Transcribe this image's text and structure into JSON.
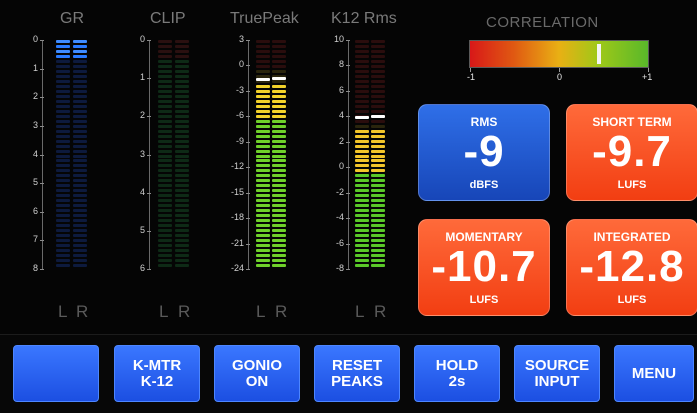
{
  "meters": {
    "gr": {
      "title": "GR",
      "scale": [
        "0",
        "1",
        "2",
        "3",
        "4",
        "5",
        "6",
        "7",
        "8"
      ],
      "left": "L",
      "right": "R"
    },
    "clip": {
      "title": "CLIP",
      "scale": [
        "0",
        "1",
        "2",
        "3",
        "4",
        "5",
        "6"
      ],
      "left": "L",
      "right": "R"
    },
    "truepeak": {
      "title": "TruePeak",
      "scale": [
        "3",
        "0",
        "-3",
        "-6",
        "-9",
        "-12",
        "-15",
        "-18",
        "-21",
        "-24"
      ],
      "left": "L",
      "right": "R",
      "level_db": -2.0,
      "peak_hold_db": -1.5
    },
    "k12": {
      "title": "K12 Rms",
      "scale": [
        "10",
        "8",
        "6",
        "4",
        "2",
        "0",
        "-2",
        "-4",
        "-6",
        "-8"
      ],
      "left": "L",
      "right": "R",
      "level_db": 3.0,
      "peak_hold_db": 4.0
    }
  },
  "correlation": {
    "title": "CORRELATION",
    "labels": [
      "-1",
      "0",
      "+1"
    ],
    "value": 0.45
  },
  "loudness": {
    "rms": {
      "title": "RMS",
      "value": "-9",
      "unit": "dBFS",
      "color": "#2a63df"
    },
    "short_term": {
      "title": "SHORT TERM",
      "value": "-9.7",
      "unit": "LUFS",
      "color": "#ff5424"
    },
    "momentary": {
      "title": "MOMENTARY",
      "value": "-10.7",
      "unit": "LUFS",
      "color": "#ff5424"
    },
    "integrated": {
      "title": "INTEGRATED",
      "value": "-12.8",
      "unit": "LUFS",
      "color": "#ff5424"
    }
  },
  "buttons": {
    "blank": {
      "line1": "",
      "line2": ""
    },
    "kmtr": {
      "line1": "K-MTR",
      "line2": "K-12"
    },
    "gonio": {
      "line1": "GONIO",
      "line2": "ON"
    },
    "reset": {
      "line1": "RESET",
      "line2": "PEAKS"
    },
    "hold": {
      "line1": "HOLD",
      "line2": "2s"
    },
    "source": {
      "line1": "SOURCE",
      "line2": "INPUT"
    },
    "menu": {
      "line1": "MENU"
    }
  }
}
